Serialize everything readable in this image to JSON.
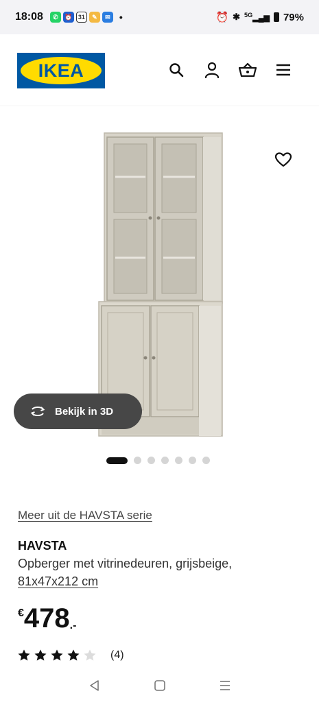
{
  "status_bar": {
    "time": "18:08",
    "network": "5G",
    "battery": "79%"
  },
  "header": {
    "logo_text": "IKEA",
    "brand_blue": "#0058a3",
    "brand_yellow": "#ffdb00"
  },
  "gallery": {
    "view_3d_label": "Bekijk in 3D",
    "dots_total": 7,
    "active_dot": 0
  },
  "product": {
    "series_link": "Meer uit de HAVSTA serie",
    "name": "HAVSTA",
    "description": "Opberger met vitrinedeuren, grijsbeige,",
    "dimensions": "81x47x212 cm",
    "price_currency": "€",
    "price_value": "478",
    "price_suffix": ".-",
    "rating": 4,
    "rating_max": 5,
    "review_count": "(4)"
  },
  "icons": {
    "search": "search-icon",
    "account": "user-icon",
    "basket": "basket-icon",
    "menu": "menu-icon",
    "favourite": "heart-icon",
    "rotate": "rotate-3d-icon"
  }
}
